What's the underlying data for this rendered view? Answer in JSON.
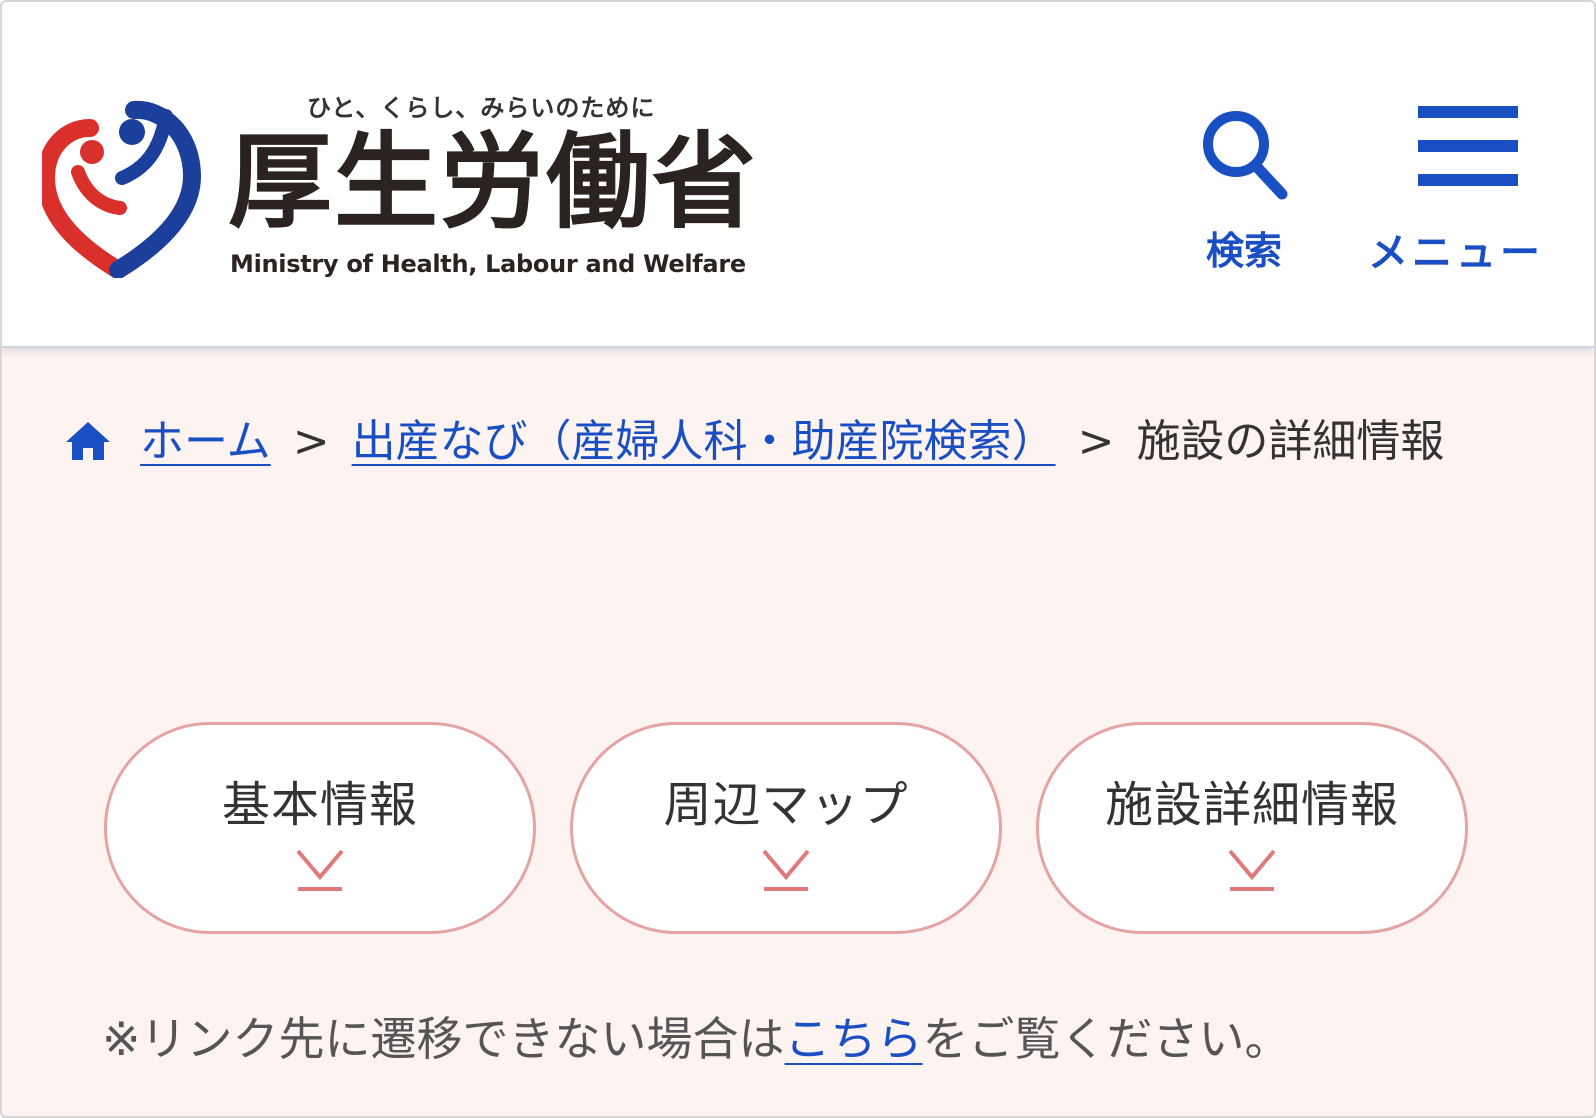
{
  "header": {
    "tagline": "ひと、くらし、みらいのために",
    "title": "厚生労働省",
    "subtitle": "Ministry of Health, Labour and Welfare",
    "logo_icon": "mhlw-heart-logo-icon",
    "search_label": "検索",
    "menu_label": "メニュー",
    "accent_color": "#1a4fc4"
  },
  "breadcrumb": {
    "home_icon": "home-icon",
    "separator": ">",
    "items": [
      {
        "label": "ホーム",
        "link": true
      },
      {
        "label": "出産なび（産婦人科・助産院検索）",
        "link": true
      },
      {
        "label": "施設の詳細情報",
        "link": false
      }
    ]
  },
  "nav_pills": [
    {
      "label": "基本情報",
      "icon": "chevron-down-to-line-icon"
    },
    {
      "label": "周辺マップ",
      "icon": "chevron-down-to-line-icon"
    },
    {
      "label": "施設詳細情報",
      "icon": "chevron-down-to-line-icon"
    }
  ],
  "note": {
    "before": "※リンク先に遷移できない場合は",
    "link": "こちら",
    "after": "をご覧ください。"
  },
  "colors": {
    "background": "#fdf3f1",
    "pill_border": "#e5a3a3",
    "arrow": "#e07a7a",
    "link": "#1a4fc4"
  }
}
